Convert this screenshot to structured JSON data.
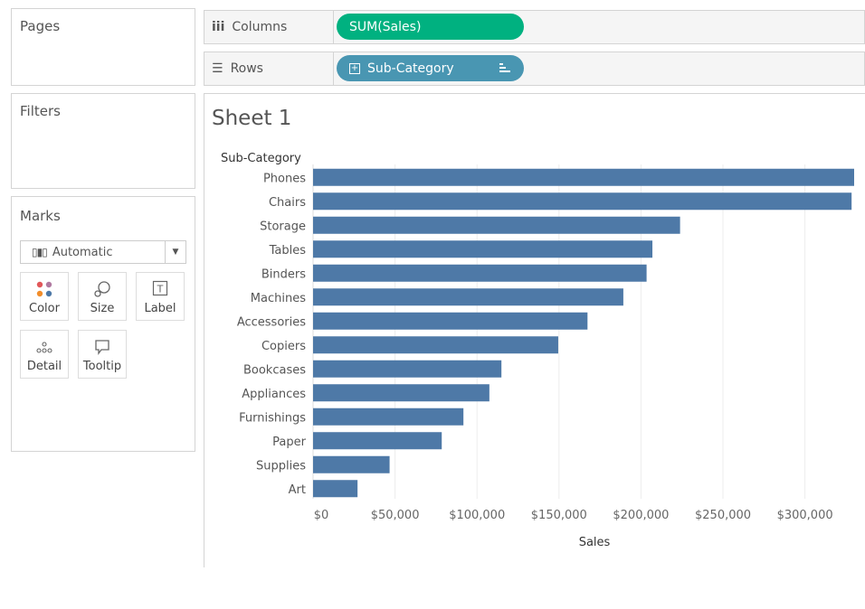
{
  "left_panel": {
    "pages_title": "Pages",
    "filters_title": "Filters",
    "marks_title": "Marks",
    "mark_type": "Automatic",
    "mark_buttons": [
      {
        "label": "Color",
        "icon": "color-dots-icon"
      },
      {
        "label": "Size",
        "icon": "size-icon"
      },
      {
        "label": "Label",
        "icon": "label-T-icon"
      },
      {
        "label": "Detail",
        "icon": "detail-dots-icon"
      },
      {
        "label": "Tooltip",
        "icon": "tooltip-icon"
      }
    ]
  },
  "shelves": {
    "columns_label": "Columns",
    "columns_pill": "SUM(Sales)",
    "rows_label": "Rows",
    "rows_pill": "Sub-Category"
  },
  "colors": {
    "bar": "#4e79a7",
    "columns_pill": "#00b180",
    "rows_pill": "#4996b2"
  },
  "sheet": {
    "title": "Sheet 1"
  },
  "chart_data": {
    "type": "bar",
    "orientation": "horizontal",
    "category_header": "Sub-Category",
    "xlabel": "Sales",
    "categories": [
      "Phones",
      "Chairs",
      "Storage",
      "Tables",
      "Binders",
      "Machines",
      "Accessories",
      "Copiers",
      "Bookcases",
      "Appliances",
      "Furnishings",
      "Paper",
      "Supplies",
      "Art"
    ],
    "values": [
      330007,
      328449,
      223844,
      206966,
      203413,
      189239,
      167380,
      149528,
      114880,
      107532,
      91705,
      78479,
      46674,
      27119
    ],
    "ticks": [
      0,
      50000,
      100000,
      150000,
      200000,
      250000,
      300000
    ],
    "tick_labels": [
      "$0",
      "$50,000",
      "$100,000",
      "$150,000",
      "$200,000",
      "$250,000",
      "$300,000"
    ],
    "xlim": [
      0,
      330007
    ],
    "grid": true
  }
}
